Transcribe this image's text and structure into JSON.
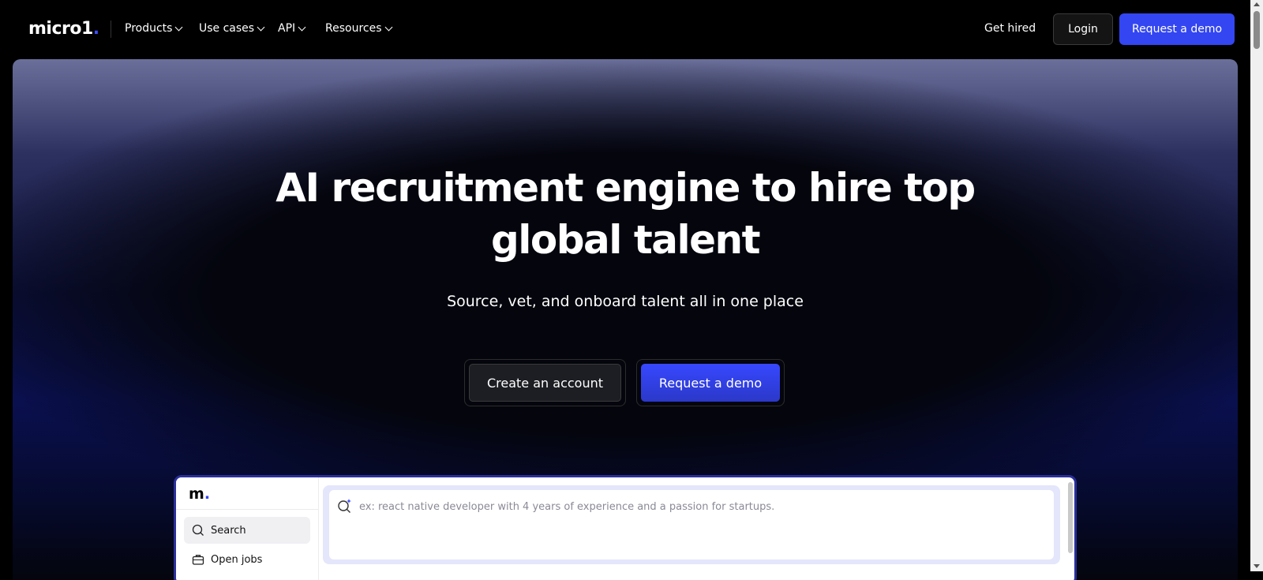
{
  "nav": {
    "logo_text": "micro1",
    "logo_dot": ".",
    "links": [
      {
        "label": "Products",
        "icon": "chevron-down-icon"
      },
      {
        "label": "Use cases",
        "icon": "chevron-down-icon"
      },
      {
        "label": "API",
        "icon": "chevron-down-icon"
      },
      {
        "label": "Resources",
        "icon": "chevron-down-icon"
      }
    ],
    "get_hired": "Get hired",
    "login": "Login",
    "request_demo": "Request a demo"
  },
  "hero": {
    "title_line1": "AI recruitment engine to hire top",
    "title_line2": "global talent",
    "subtitle": "Source, vet, and onboard talent all in one place",
    "cta_primary": "Create an account",
    "cta_secondary": "Request a demo"
  },
  "app_preview": {
    "logo_text": "m",
    "logo_dot": ".",
    "sidebar_items": [
      {
        "label": "Search",
        "icon": "search-icon"
      },
      {
        "label": "Open jobs",
        "icon": "briefcase-icon"
      }
    ],
    "search_placeholder": "ex: react native developer with 4 years of experience and a passion for startups.",
    "search_icon": "sparkle-search-icon"
  },
  "colors": {
    "brand_blue": "#3346f2",
    "background": "#000000"
  }
}
